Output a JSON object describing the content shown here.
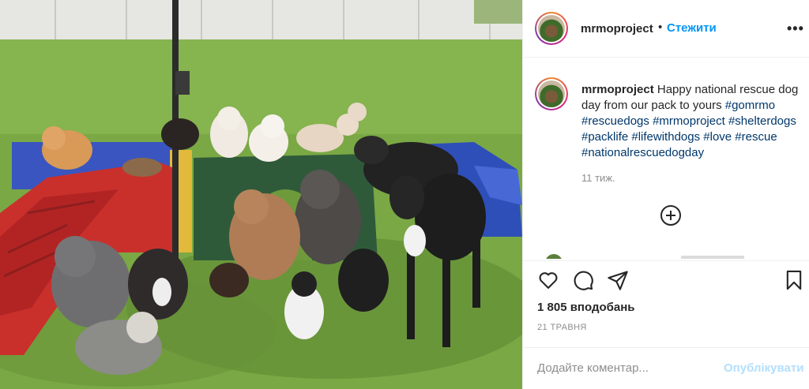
{
  "post": {
    "username": "mrmoproject",
    "follow_label": "Стежити",
    "separator": "•",
    "more_label": "•••",
    "caption_username": "mrmoproject",
    "caption_text": "Happy national rescue dog day from our pack to yours",
    "hashtags": [
      "#gomrmo",
      "#rescuedogs",
      "#mrmoproject",
      "#shelterdogs",
      "#packlife",
      "#lifewithdogs",
      "#love",
      "#rescue",
      "#nationalrescuedogday"
    ],
    "time_ago": "11 тиж.",
    "likes_text": "1 805 вподобань",
    "date": "21 ТРАВНЯ",
    "comment_placeholder": "Додайте коментар...",
    "publish_label": "Опублікувати"
  },
  "icons": {
    "like": "heart-icon",
    "comment": "comment-icon",
    "share": "share-icon",
    "save": "bookmark-icon",
    "more": "more-options-icon",
    "load_more": "plus-circle-icon"
  },
  "colors": {
    "link_blue": "#0095f6",
    "hashtag_blue": "#00376b",
    "muted": "#8e8e8e",
    "publish_disabled": "#b2dffc",
    "border": "#efefef"
  }
}
